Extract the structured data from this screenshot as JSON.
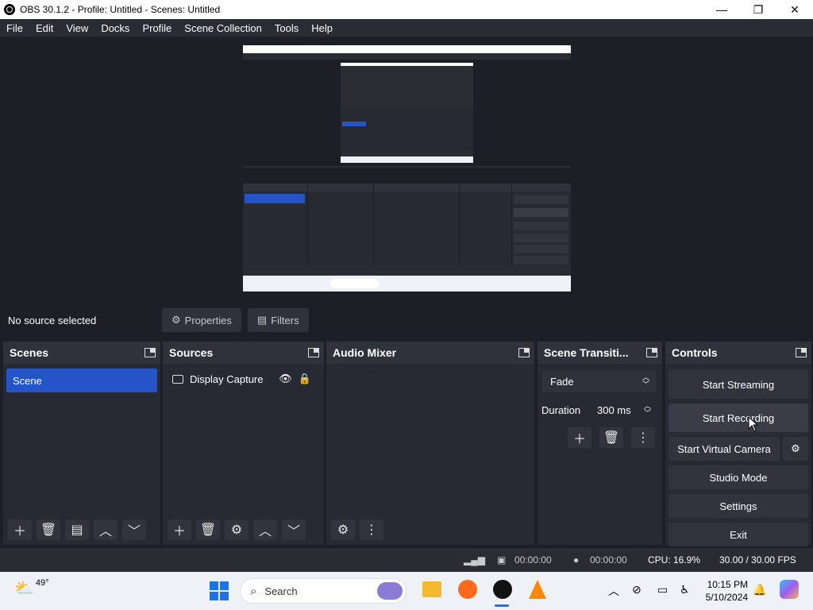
{
  "window": {
    "title": "OBS 30.1.2 - Profile: Untitled - Scenes: Untitled",
    "minimize": "—",
    "maximize": "❐",
    "close": "✕"
  },
  "menu": [
    "File",
    "Edit",
    "View",
    "Docks",
    "Profile",
    "Scene Collection",
    "Tools",
    "Help"
  ],
  "context": {
    "no_source": "No source selected",
    "properties": "Properties",
    "filters": "Filters"
  },
  "scenes": {
    "title": "Scenes",
    "items": [
      "Scene"
    ]
  },
  "sources": {
    "title": "Sources",
    "items": [
      "Display Capture"
    ]
  },
  "audio_mixer": {
    "title": "Audio Mixer"
  },
  "transitions": {
    "title": "Scene Transiti...",
    "selected": "Fade",
    "duration_label": "Duration",
    "duration_value": "300 ms"
  },
  "controls": {
    "title": "Controls",
    "start_streaming": "Start Streaming",
    "start_recording": "Start Recording",
    "start_virtual_camera": "Start Virtual Camera",
    "studio_mode": "Studio Mode",
    "settings": "Settings",
    "exit": "Exit"
  },
  "status": {
    "stream_time": "00:00:00",
    "record_time": "00:00:00",
    "cpu": "CPU: 16.9%",
    "fps": "30.00 / 30.00 FPS"
  },
  "taskbar": {
    "weather_temp": "49°",
    "search_placeholder": "Search",
    "time": "10:15 PM",
    "date": "5/10/2024"
  },
  "colors": {
    "accent": "#2553c8",
    "panel": "#272a33",
    "header": "#2f323b",
    "background": "#1d1f26"
  }
}
